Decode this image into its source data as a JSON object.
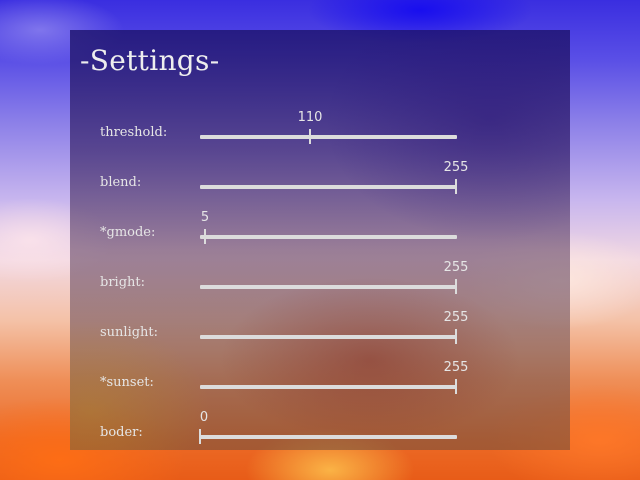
{
  "title": "-Settings-",
  "range_max": 255,
  "settings": [
    {
      "label": "threshold:",
      "value": 110
    },
    {
      "label": "blend:",
      "value": 255
    },
    {
      "label": "*gmode:",
      "value": 5
    },
    {
      "label": "bright:",
      "value": 255
    },
    {
      "label": "sunlight:",
      "value": 255
    },
    {
      "label": "*sunset:",
      "value": 255
    },
    {
      "label": "boder:",
      "value": 0
    }
  ]
}
